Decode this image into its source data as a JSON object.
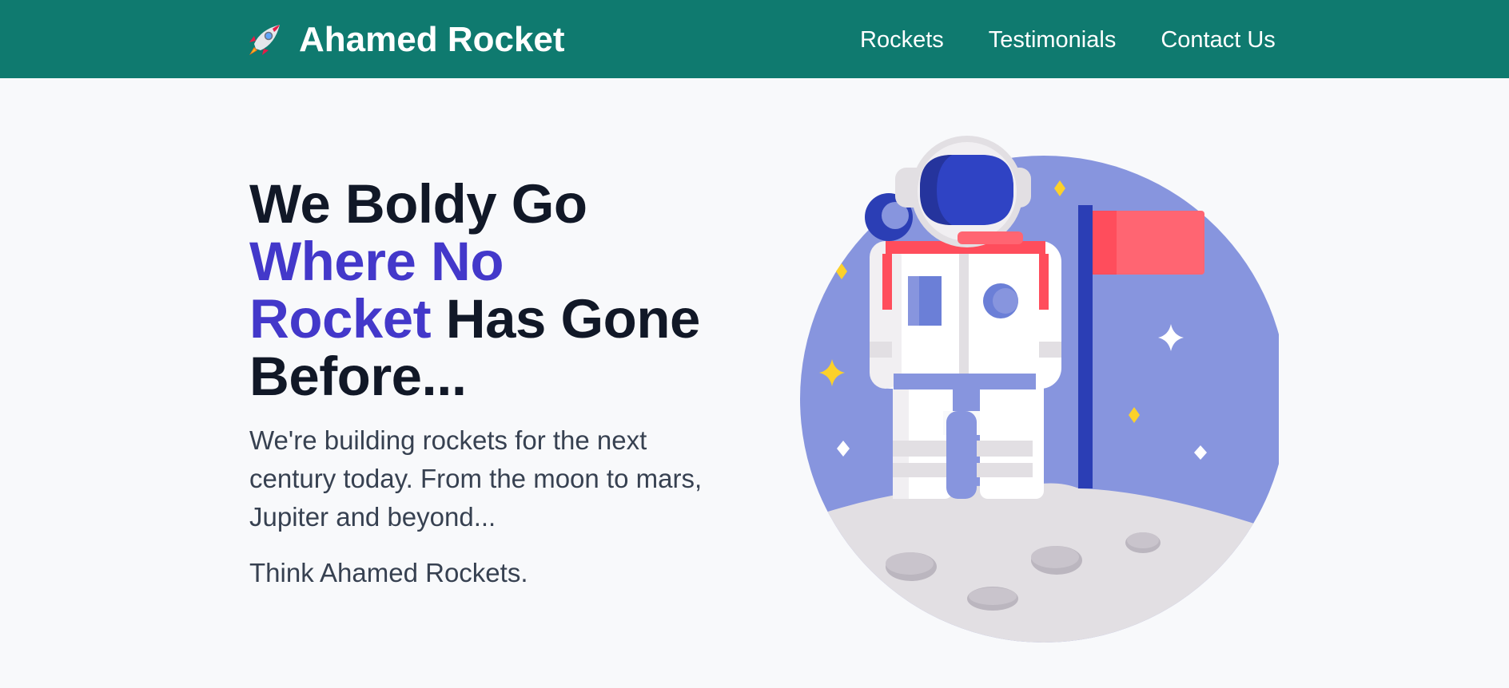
{
  "brand": {
    "name": "Ahamed Rocket",
    "logo_icon": "rocket-icon"
  },
  "nav": {
    "items": [
      {
        "label": "Rockets"
      },
      {
        "label": "Testimonials"
      },
      {
        "label": "Contact Us"
      }
    ]
  },
  "hero": {
    "heading": {
      "line1": "We Boldy Go",
      "line2_accent": "Where No",
      "line3_accent": "Rocket",
      "line3_rest": " Has Gone",
      "line4": "Before..."
    },
    "description": "We're building rockets for the next century today. From the moon to mars, Jupiter and beyond...",
    "tagline": "Think Ahamed Rockets.",
    "illustration_icon": "astronaut-on-moon-illustration"
  },
  "colors": {
    "navbar_bg": "#0f7a6f",
    "accent": "#4338ca",
    "heading": "#111827",
    "body_text": "#374151",
    "page_bg": "#f8f9fb"
  }
}
